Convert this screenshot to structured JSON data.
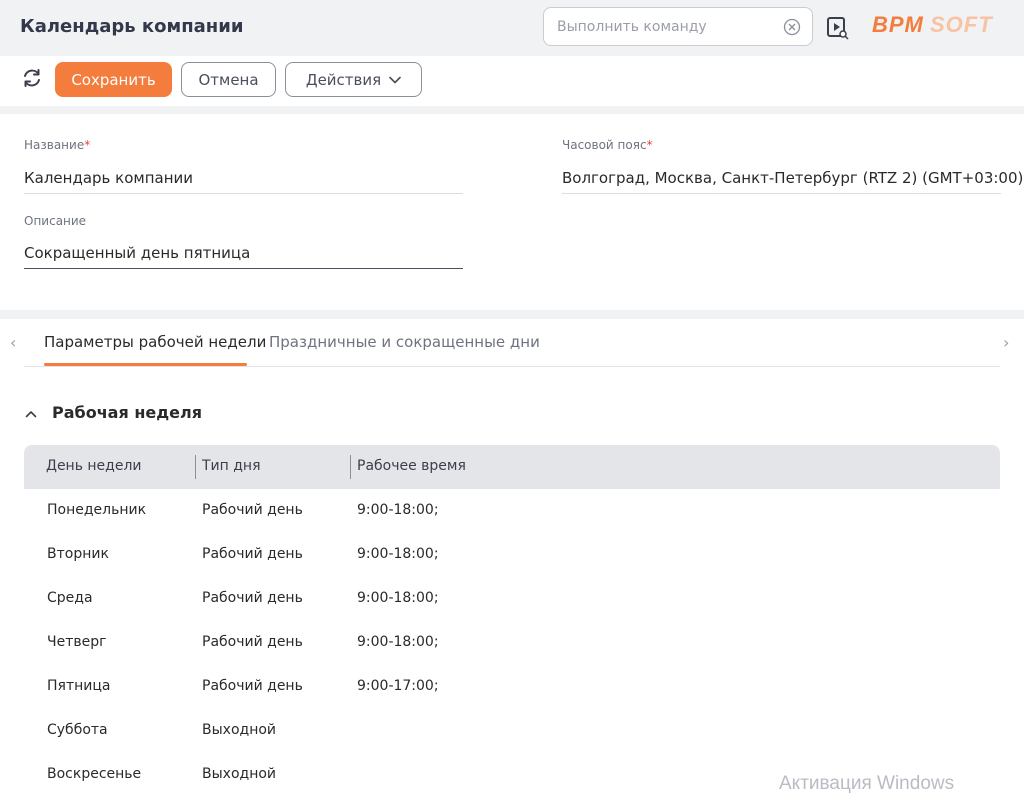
{
  "header": {
    "title": "Календарь компании",
    "command_placeholder": "Выполнить команду",
    "logo_text": "BPMSOFT",
    "brand_color": "#f47c3c"
  },
  "toolbar": {
    "save_label": "Сохранить",
    "cancel_label": "Отмена",
    "actions_label": "Действия"
  },
  "form": {
    "name_label": "Название",
    "name_value": "Календарь компании",
    "timezone_label": "Часовой пояс",
    "timezone_value": "Волгоград, Москва, Санкт-Петербург (RTZ 2) (GMT+03:00)",
    "description_label": "Описание",
    "description_value": "Сокращенный день пятница",
    "required_mark": "*"
  },
  "tabs": [
    {
      "label": "Параметры рабочей недели",
      "active": true
    },
    {
      "label": "Праздничные и сокращенные дни",
      "active": false
    }
  ],
  "group": {
    "title": "Рабочая неделя"
  },
  "table": {
    "columns": [
      "День недели",
      "Тип дня",
      "Рабочее время"
    ],
    "rows": [
      [
        "Понедельник",
        "Рабочий день",
        "9:00-18:00;"
      ],
      [
        "Вторник",
        "Рабочий день",
        "9:00-18:00;"
      ],
      [
        "Среда",
        "Рабочий день",
        "9:00-18:00;"
      ],
      [
        "Четверг",
        "Рабочий день",
        "9:00-18:00;"
      ],
      [
        "Пятница",
        "Рабочий день",
        "9:00-17:00;"
      ],
      [
        "Суббота",
        "Выходной",
        ""
      ],
      [
        "Воскресенье",
        "Выходной",
        ""
      ]
    ]
  },
  "watermark": "Активация Windows"
}
